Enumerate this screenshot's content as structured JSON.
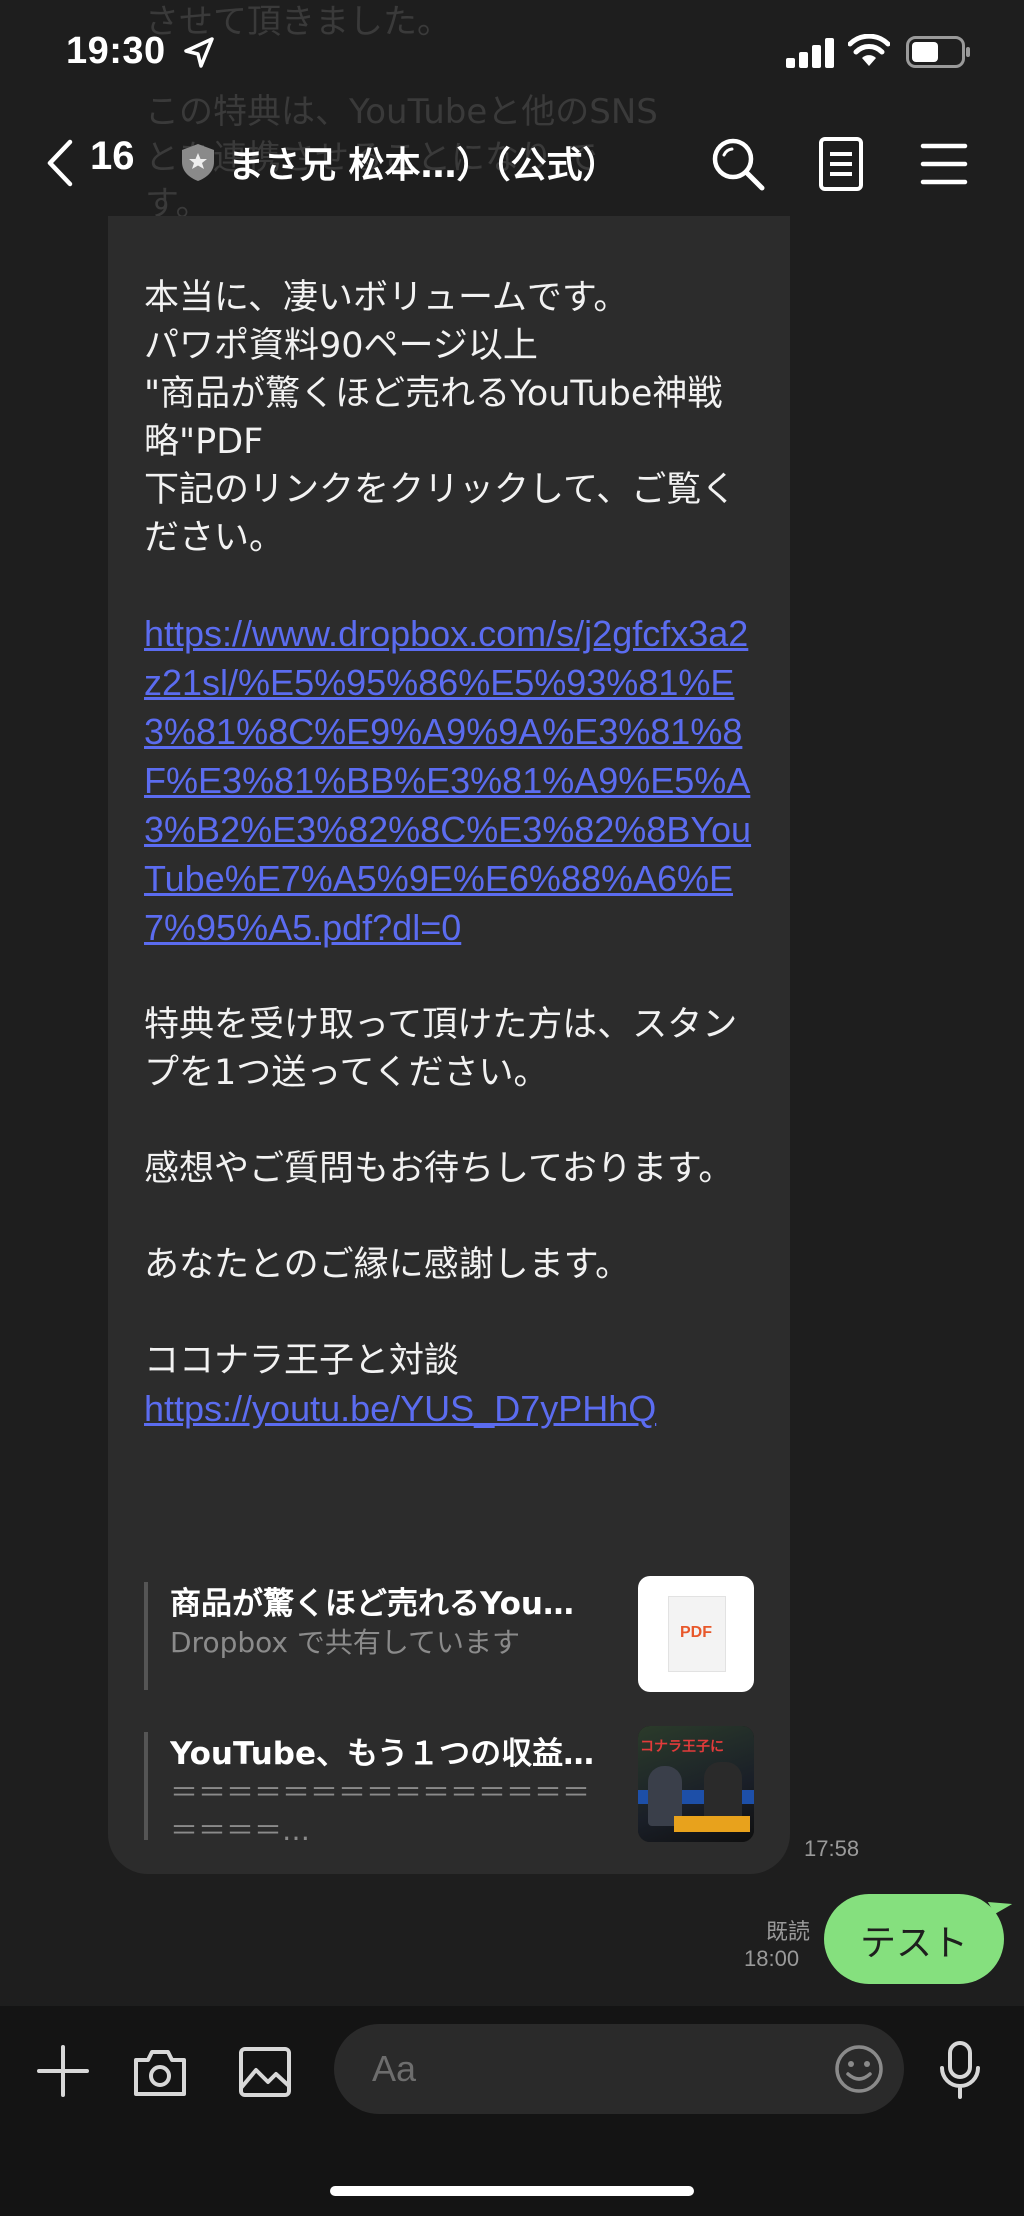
{
  "status": {
    "time": "19:30"
  },
  "ghost_lines": [
    "させて頂きました。",
    "この特典は、YouTubeと他のSNS",
    "とを連携させることになり    で",
    "す。"
  ],
  "header": {
    "back_count": "16",
    "title": "まさ兄 松本…）（公式）"
  },
  "message": {
    "para1": [
      "本当に、凄いボリュームです。",
      "パワポ資料90ページ以上",
      "\"商品が驚くほど売れるYouTube神戦略\"PDF",
      "下記のリンクをクリックして、ご覧ください。"
    ],
    "link1": "https://www.dropbox.com/s/j2gfcfx3a2z21sl/%E5%95%86%E5%93%81%E3%81%8C%E9%A9%9A%E3%81%8F%E3%81%BB%E3%81%A9%E5%A3%B2%E3%82%8C%E3%82%8BYouTube%E7%A5%9E%E6%88%A6%E7%95%A5.pdf?dl=0",
    "para2": "特典を受け取って頂けた方は、スタンプを1つ送ってください。",
    "para3": "感想やご質問もお待ちしております。",
    "para4": "あなたとのご縁に感謝します。",
    "para5": "ココナラ王子と対談",
    "link2": "https://youtu.be/YUS_D7yPHhQ",
    "time": "17:58"
  },
  "previews": [
    {
      "title": "商品が驚くほど売れるYou…",
      "sub_brand": "Dropbox",
      "sub_rest": " で共有しています",
      "thumb_label": "PDF"
    },
    {
      "title": "YouTube、もう１つの収益…",
      "sub": "＝＝＝＝＝＝＝＝＝＝＝＝＝＝＝＝＝＝＝…",
      "thumb_text": "コナラ王子に"
    }
  ],
  "sent": {
    "read": "既読",
    "time": "18:00",
    "text": "テスト"
  },
  "input": {
    "placeholder": "Aa"
  },
  "colors": {
    "link": "#5b6cf0",
    "sent_bubble": "#85e07e",
    "bubble": "#2c2c2c",
    "background": "#1e1e1e"
  }
}
